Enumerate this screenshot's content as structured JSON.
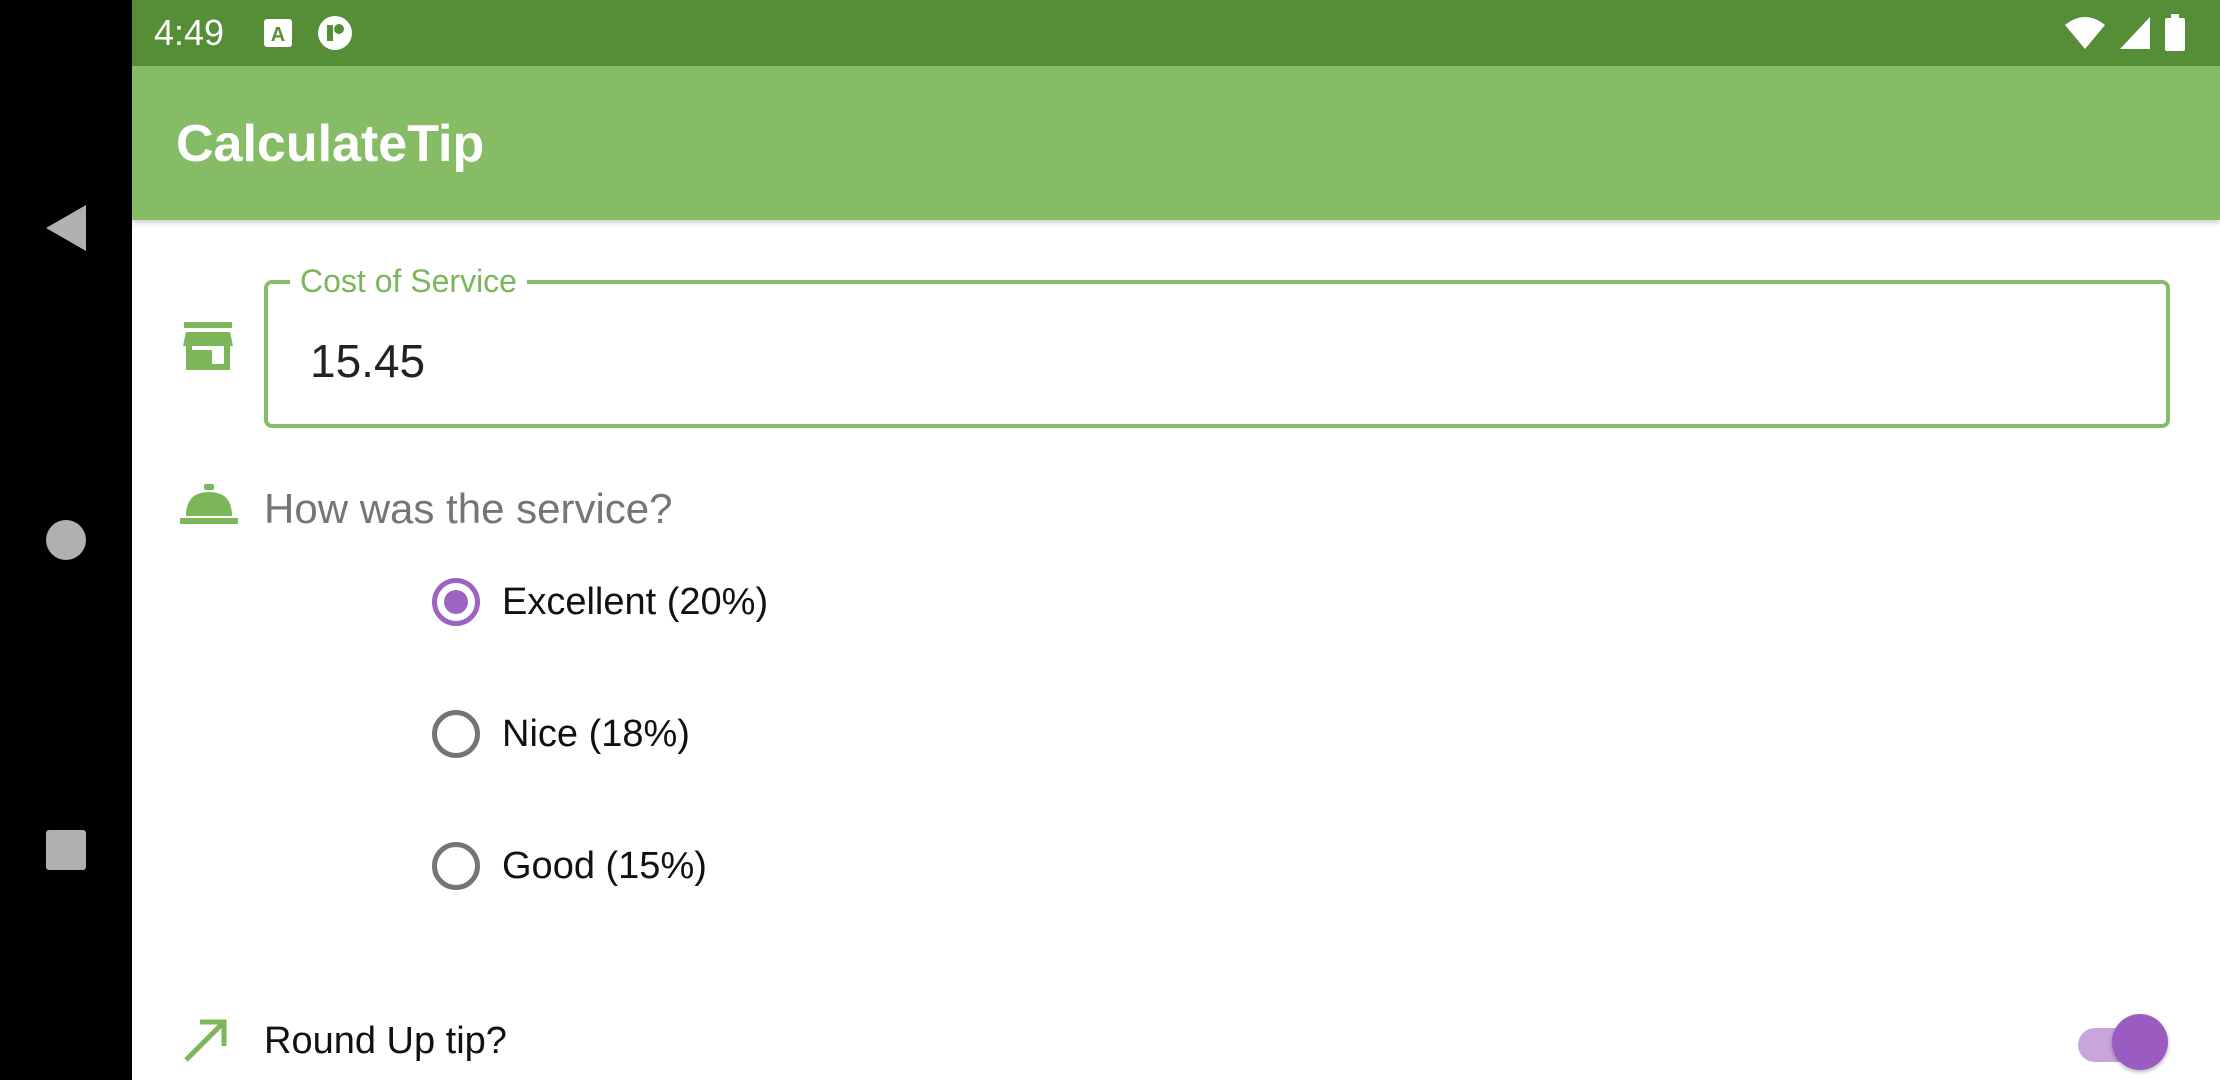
{
  "status_bar": {
    "time": "4:49",
    "icons": [
      "accessibility-a-icon",
      "tracker-app-icon",
      "wifi-icon",
      "cell-signal-icon",
      "battery-icon"
    ]
  },
  "nav_bar": {
    "back": "back-triangle-icon",
    "home": "home-circle-icon",
    "recents": "recents-square-icon"
  },
  "app_bar": {
    "title": "CalculateTip"
  },
  "cost_field": {
    "label": "Cost of Service",
    "value": "15.45",
    "icon": "store-icon"
  },
  "service": {
    "question": "How was the service?",
    "icon": "room-service-bell-icon",
    "options": [
      {
        "label": "Excellent (20%)",
        "checked": true
      },
      {
        "label": "Nice (18%)",
        "checked": false
      },
      {
        "label": "Good (15%)",
        "checked": false
      }
    ]
  },
  "round_up": {
    "label": "Round Up tip?",
    "icon": "trending-arrow-icon",
    "enabled": true
  },
  "colors": {
    "status_bar": "#568d37",
    "app_bar": "#86bc66",
    "accent_green": "#7cb65a",
    "radio_purple": "#9c64c0",
    "switch_track": "#c8a6dc",
    "switch_thumb": "#9a5cc0"
  }
}
